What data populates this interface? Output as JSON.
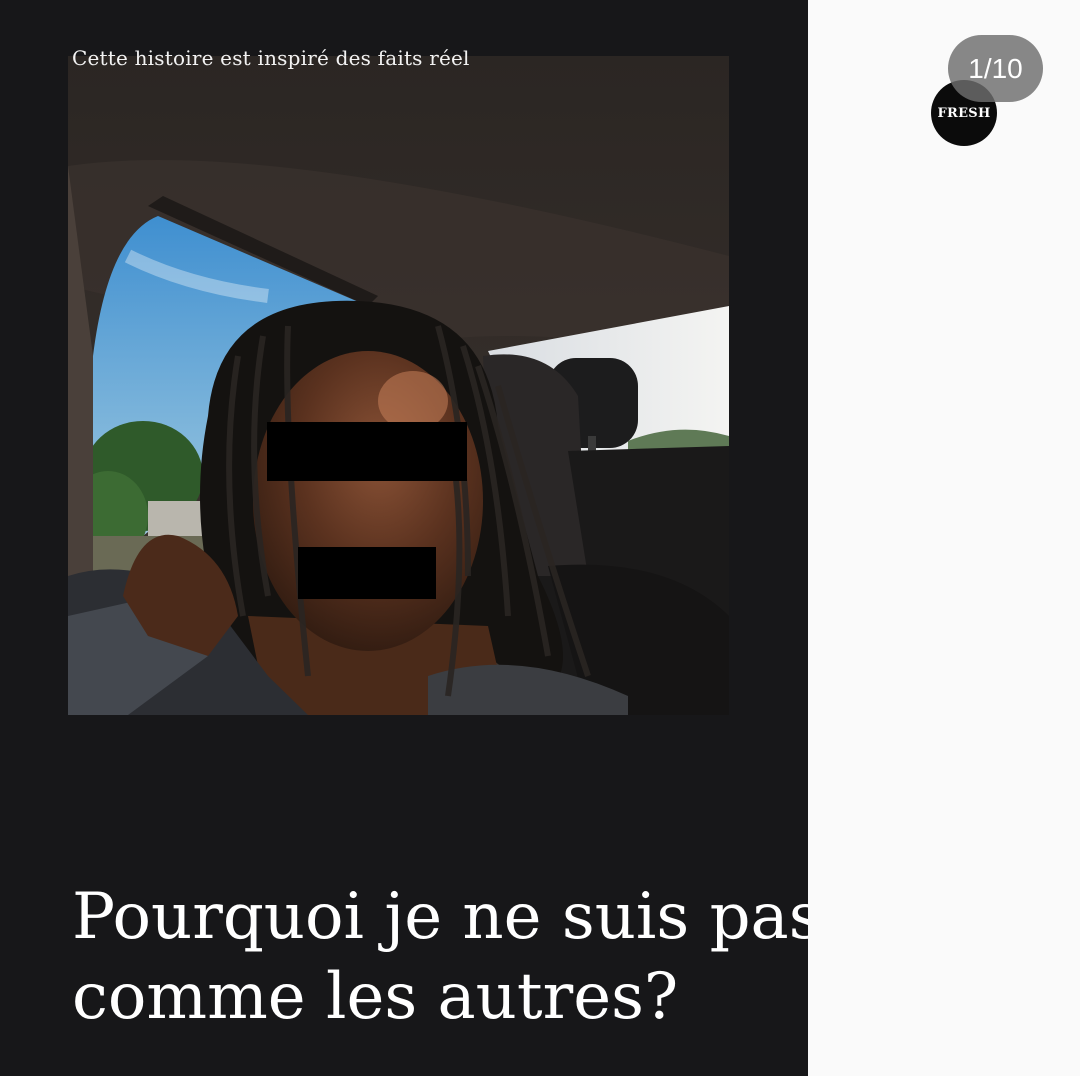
{
  "post": {
    "disclaimer": "Cette histoire est inspiré des faits réel",
    "headline_line1": "Pourquoi je ne suis pas",
    "headline_line2": "comme les autres?",
    "brand": "FRESH",
    "page_counter": "1/10",
    "current_slide": 1,
    "total_slides": 10
  },
  "colors": {
    "slide_background": "#171719",
    "page_background": "#fafafa",
    "text": "#ffffff",
    "censor_bar": "#000000"
  }
}
